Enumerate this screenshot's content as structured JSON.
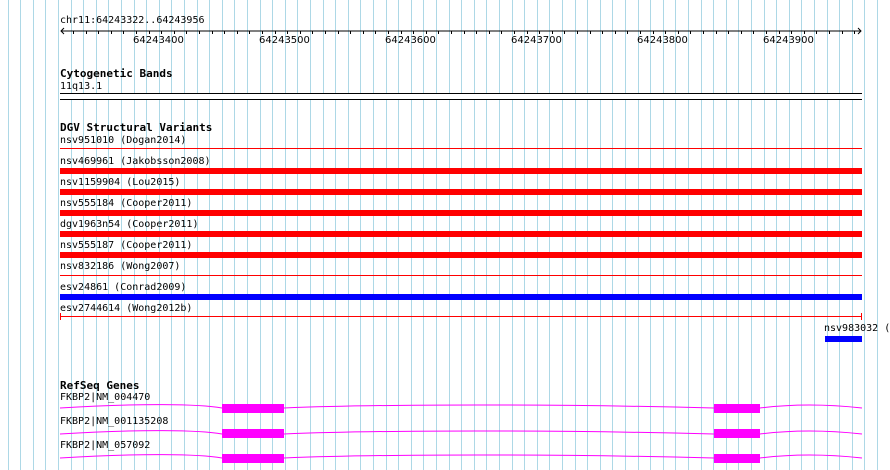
{
  "ruler": {
    "location": "chr11:64243322..64243956",
    "ticks": [
      "64243400",
      "64243500",
      "64243600",
      "64243700",
      "64243800",
      "64243900"
    ]
  },
  "cytoband": {
    "title": "Cytogenetic Bands",
    "band": "11q13.1"
  },
  "dgv": {
    "title": "DGV Structural Variants",
    "variants": [
      {
        "label": "nsv951010 (Dogan2014)",
        "color": "#ff0000",
        "style": "thin"
      },
      {
        "label": "nsv469961 (Jakobsson2008)",
        "color": "#ff0000",
        "style": "thick"
      },
      {
        "label": "nsv1159904 (Lou2015)",
        "color": "#ff0000",
        "style": "thick"
      },
      {
        "label": "nsv555184 (Cooper2011)",
        "color": "#ff0000",
        "style": "thick"
      },
      {
        "label": "dgv1963n54 (Cooper2011)",
        "color": "#ff0000",
        "style": "thick"
      },
      {
        "label": "nsv555187 (Cooper2011)",
        "color": "#ff0000",
        "style": "thick"
      },
      {
        "label": "nsv832186 (Wong2007)",
        "color": "#ff0000",
        "style": "thin"
      },
      {
        "label": "esv24861 (Conrad2009)",
        "color": "#0000ff",
        "style": "thick"
      },
      {
        "label": "esv2744614 (Wong2012b)",
        "color": "#ff0000",
        "style": "thin-capped"
      }
    ],
    "extra_label": "nsv983032 (",
    "extra_color": "#0000ff"
  },
  "refseq": {
    "title": "RefSeq Genes",
    "genes": [
      {
        "label": "FKBP2|NM_004470"
      },
      {
        "label": "FKBP2|NM_001135208"
      },
      {
        "label": "FKBP2|NM_057092"
      }
    ],
    "color": "#ff00ff"
  },
  "colors": {
    "grid": "#add8e6",
    "ruler": "#000000"
  }
}
